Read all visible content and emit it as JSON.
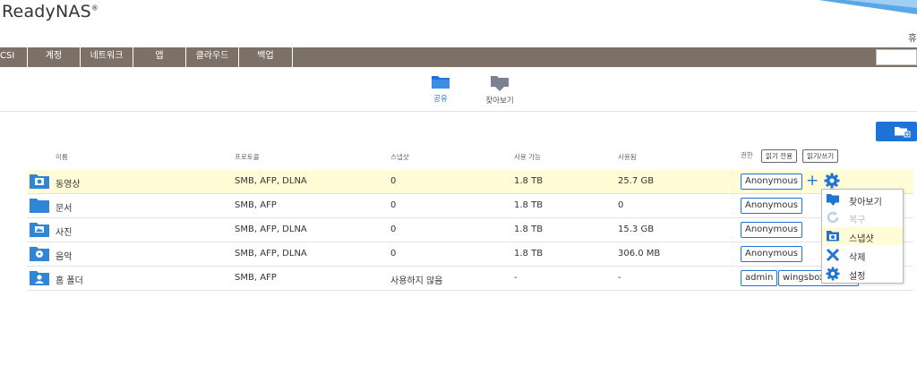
{
  "app": {
    "logo": "ReadyNAS",
    "logo_mark": "®",
    "top_right_text": "휴"
  },
  "nav": {
    "items": [
      "CSI",
      "계정",
      "네트워크",
      "앱",
      "클라우드",
      "백업"
    ]
  },
  "subtabs": [
    {
      "label": "공유",
      "icon": "shares-folder-icon",
      "active": true
    },
    {
      "label": "찾아보기",
      "icon": "browse-icon",
      "active": false
    }
  ],
  "table": {
    "headers": {
      "name": "이름",
      "protocol": "프로토콜",
      "snapshot": "스냅샷",
      "available": "사용 가능",
      "used": "사용됨",
      "perm": "권한"
    },
    "perm_chips": [
      "읽기 전용",
      "읽기/쓰기"
    ],
    "rows": [
      {
        "name": "동영상",
        "icon": "video-folder-icon",
        "protocol": "SMB, AFP, DLNA",
        "snapshot": "0",
        "available": "1.8 TB",
        "used": "25.7 GB",
        "users": [
          "Anonymous"
        ]
      },
      {
        "name": "문서",
        "icon": "folder-icon",
        "protocol": "SMB, AFP",
        "snapshot": "0",
        "available": "1.8 TB",
        "used": "0",
        "users": [
          "Anonymous"
        ]
      },
      {
        "name": "사진",
        "icon": "photo-folder-icon",
        "protocol": "SMB, AFP, DLNA",
        "snapshot": "0",
        "available": "1.8 TB",
        "used": "15.3 GB",
        "users": [
          "Anonymous"
        ]
      },
      {
        "name": "음악",
        "icon": "music-folder-icon",
        "protocol": "SMB, AFP, DLNA",
        "snapshot": "0",
        "available": "1.8 TB",
        "used": "306.0 MB",
        "users": [
          "Anonymous"
        ]
      },
      {
        "name": "홈 폴더",
        "icon": "home-folder-icon",
        "protocol": "SMB, AFP",
        "snapshot": "사용하지 않음",
        "available": "-",
        "used": "-",
        "users": [
          "admin",
          "wingsbox@"
        ]
      }
    ]
  },
  "context_menu": {
    "items": [
      {
        "label": "찾아보기",
        "icon": "browse-icon",
        "disabled": false,
        "highlighted": false
      },
      {
        "label": "복구",
        "icon": "restore-icon",
        "disabled": true,
        "highlighted": false
      },
      {
        "label": "스냅샷",
        "icon": "snapshot-icon",
        "disabled": false,
        "highlighted": true
      },
      {
        "label": "삭제",
        "icon": "delete-icon",
        "disabled": false,
        "highlighted": false
      },
      {
        "label": "설정",
        "icon": "settings-gear-icon",
        "disabled": false,
        "highlighted": false
      }
    ]
  },
  "colors": {
    "nav_bg": "#7d7066",
    "accent": "#1f74d6",
    "selected_row": "#fffcd6"
  }
}
